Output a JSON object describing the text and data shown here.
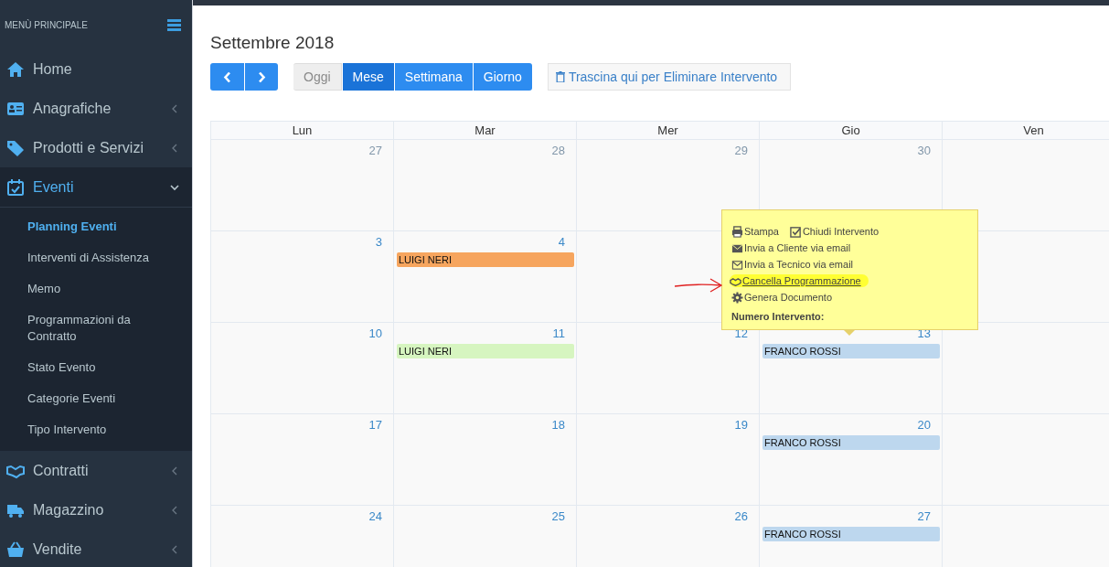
{
  "sidebar": {
    "header": "MENÙ PRINCIPALE",
    "items": [
      {
        "label": "Home",
        "expandable": false,
        "expanded": false
      },
      {
        "label": "Anagrafiche",
        "expandable": true,
        "expanded": false
      },
      {
        "label": "Prodotti e Servizi",
        "expandable": true,
        "expanded": false
      },
      {
        "label": "Eventi",
        "expandable": true,
        "expanded": true,
        "children": [
          {
            "label": "Planning Eventi",
            "selected": true
          },
          {
            "label": "Interventi di Assistenza",
            "selected": false
          },
          {
            "label": "Memo",
            "selected": false
          },
          {
            "label": "Programmazioni da Contratto",
            "selected": false
          },
          {
            "label": "Stato Evento",
            "selected": false
          },
          {
            "label": "Categorie Eventi",
            "selected": false
          },
          {
            "label": "Tipo Intervento",
            "selected": false
          }
        ]
      },
      {
        "label": "Contratti",
        "expandable": true,
        "expanded": false
      },
      {
        "label": "Magazzino",
        "expandable": true,
        "expanded": false
      },
      {
        "label": "Vendite",
        "expandable": true,
        "expanded": false
      }
    ]
  },
  "title": "Settembre 2018",
  "toolbar": {
    "today": {
      "label": "Oggi",
      "disabled": true
    },
    "views": [
      {
        "label": "Mese",
        "selected": true
      },
      {
        "label": "Settimana",
        "selected": false
      },
      {
        "label": "Giorno",
        "selected": false
      }
    ],
    "trash": "Trascina qui per Eliminare Intervento"
  },
  "calendar": {
    "columns": [
      "Lun",
      "Mar",
      "Mer",
      "Gio",
      "Ven"
    ],
    "weeks": [
      [
        {
          "day": "27",
          "muted": true
        },
        {
          "day": "28",
          "muted": true
        },
        {
          "day": "29",
          "muted": true
        },
        {
          "day": "30",
          "muted": true
        }
      ],
      [
        {
          "day": "3",
          "muted": false
        },
        {
          "day": "4",
          "muted": false,
          "events": [
            {
              "title": "LUIGI NERI",
              "color": "#f6a55e"
            }
          ]
        }
      ],
      [
        {
          "day": "10",
          "muted": false
        },
        {
          "day": "11",
          "muted": false,
          "events": [
            {
              "title": "LUIGI NERI",
              "color": "#d6f5c0"
            }
          ]
        },
        {
          "day": "12",
          "muted": false
        },
        {
          "day": "13",
          "muted": false,
          "events": [
            {
              "title": "FRANCO ROSSI",
              "color": "#bdd7ee"
            }
          ]
        }
      ],
      [
        {
          "day": "17",
          "muted": false
        },
        {
          "day": "18",
          "muted": false
        },
        {
          "day": "19",
          "muted": false
        },
        {
          "day": "20",
          "muted": false,
          "events": [
            {
              "title": "FRANCO ROSSI",
              "color": "#bdd7ee"
            }
          ]
        }
      ],
      [
        {
          "day": "24",
          "muted": false
        },
        {
          "day": "25",
          "muted": false
        },
        {
          "day": "26",
          "muted": false
        },
        {
          "day": "27",
          "muted": false,
          "events": [
            {
              "title": "FRANCO ROSSI",
              "color": "#bdd7ee"
            }
          ]
        }
      ]
    ]
  },
  "popup": {
    "rows": [
      [
        {
          "label": "Stampa",
          "highlighted": false
        },
        {
          "label": "Chiudi Intervento",
          "highlighted": false
        }
      ],
      [
        {
          "label": "Invia a Cliente via email",
          "highlighted": false
        }
      ],
      [
        {
          "label": "Invia a Tecnico via email",
          "highlighted": false
        }
      ],
      [
        {
          "label": "Cancella Programmazione",
          "highlighted": true
        }
      ],
      [
        {
          "label": "Genera Documento",
          "highlighted": false
        }
      ]
    ],
    "footer": "Numero Intervento:"
  }
}
